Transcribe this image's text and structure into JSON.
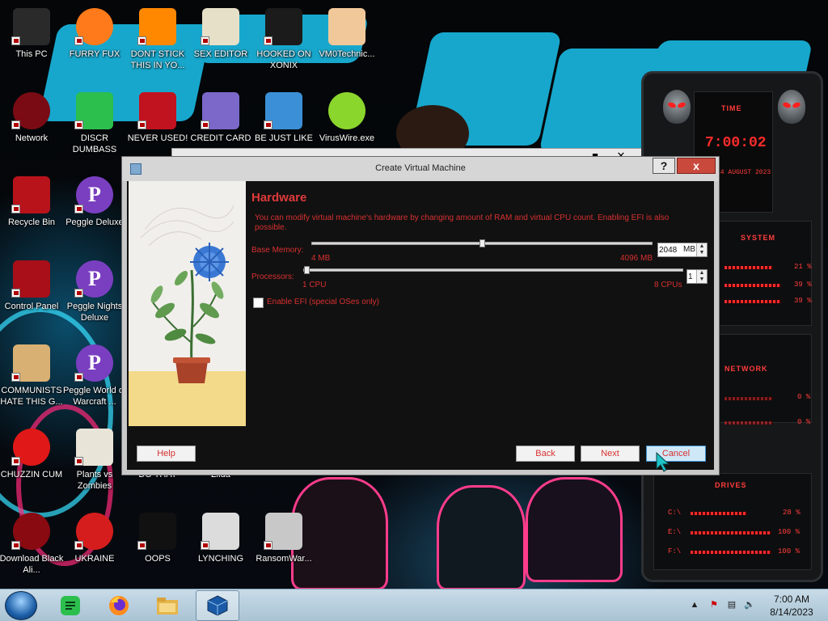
{
  "desktop_icons": [
    {
      "label": "This PC",
      "kind": "pc-icon"
    },
    {
      "label": "FURRY FUX",
      "kind": "firefox-icon"
    },
    {
      "label": "DONT STICK THIS IN YO...",
      "kind": "vlc-icon"
    },
    {
      "label": "SEX EDITOR",
      "kind": "hex-editor-icon"
    },
    {
      "label": "HOOKED ON XONIX",
      "kind": "xonix-icon"
    },
    {
      "label": "VM0Technic...",
      "kind": "doctor-icon"
    },
    {
      "label": "Network",
      "kind": "network-icon"
    },
    {
      "label": "DISCR DUMBASS",
      "kind": "chat-icon"
    },
    {
      "label": "NEVER USED!",
      "kind": "devcpp-icon"
    },
    {
      "label": "CREDIT CARD",
      "kind": "credit-card-icon"
    },
    {
      "label": "BE JUST LIKE",
      "kind": "santa-icon"
    },
    {
      "label": "VirusWire.exe",
      "kind": "lime-icon"
    },
    {
      "label": "Recycle Bin",
      "kind": "recycle-bin-icon"
    },
    {
      "label": "Peggle Deluxe",
      "kind": "peggle-icon"
    },
    {
      "label": "Control Panel",
      "kind": "control-panel-icon"
    },
    {
      "label": "Peggle Nights Deluxe",
      "kind": "peggle-icon"
    },
    {
      "label": "COMMUNISTS HATE THIS G...",
      "kind": "money-bag-icon"
    },
    {
      "label": "Peggle World of Warcraft ...",
      "kind": "peggle-icon"
    },
    {
      "label": "CHUZZIN CUM",
      "kind": "chuzzle-icon"
    },
    {
      "label": "Plants vs Zombies",
      "kind": "flower-icon"
    },
    {
      "label": "DO THAT",
      "kind": "blank-icon"
    },
    {
      "label": "Zilda",
      "kind": "blank-icon"
    },
    {
      "label": "Download Black Ali...",
      "kind": "alien-icon"
    },
    {
      "label": "UKRAINE",
      "kind": "radiation-icon"
    },
    {
      "label": "OOPS",
      "kind": "skull-app-icon"
    },
    {
      "label": "LYNCHING",
      "kind": "gallows-icon"
    },
    {
      "label": "RansomWar...",
      "kind": "skull-icon"
    }
  ],
  "dialog": {
    "title": "Create Virtual Machine",
    "help_glyph": "?",
    "close_glyph": "x",
    "heading": "Hardware",
    "description": "You can modify virtual machine's hardware by changing amount of RAM and virtual CPU count. Enabling EFI is also possible.",
    "memory": {
      "label": "Base Memory:",
      "min_label": "4 MB",
      "max_label": "4096 MB",
      "min": 4,
      "max": 4096,
      "value": "2048",
      "unit": "MB"
    },
    "processors": {
      "label": "Processors:",
      "min_label": "1 CPU",
      "max_label": "8 CPUs",
      "min": 1,
      "max": 8,
      "value": "1"
    },
    "efi": {
      "label": "Enable EFI (special OSes only)",
      "checked": false
    },
    "buttons": {
      "help": "Help",
      "back": "Back",
      "next": "Next",
      "cancel": "Cancel"
    }
  },
  "gadget": {
    "time_title": "TIME",
    "time_value": "7:00:02",
    "date_value": "14 AUGUST 2023",
    "system_title": "SYSTEM",
    "system_values": [
      "21 %",
      "39 %",
      "39 %"
    ],
    "network_title": "NETWORK",
    "network_values": [
      "0 %",
      "0 %"
    ],
    "drives_title": "DRIVES",
    "drives": [
      {
        "label": "C:\\",
        "value": "28 %"
      },
      {
        "label": "E:\\",
        "value": "100 %"
      },
      {
        "label": "F:\\",
        "value": "100 %"
      }
    ]
  },
  "taskbar": {
    "time": "7:00 AM",
    "date": "8/14/2023"
  },
  "colors": {
    "accent_red": "#d83030",
    "wallpaper_cyan": "#17a7cc"
  }
}
